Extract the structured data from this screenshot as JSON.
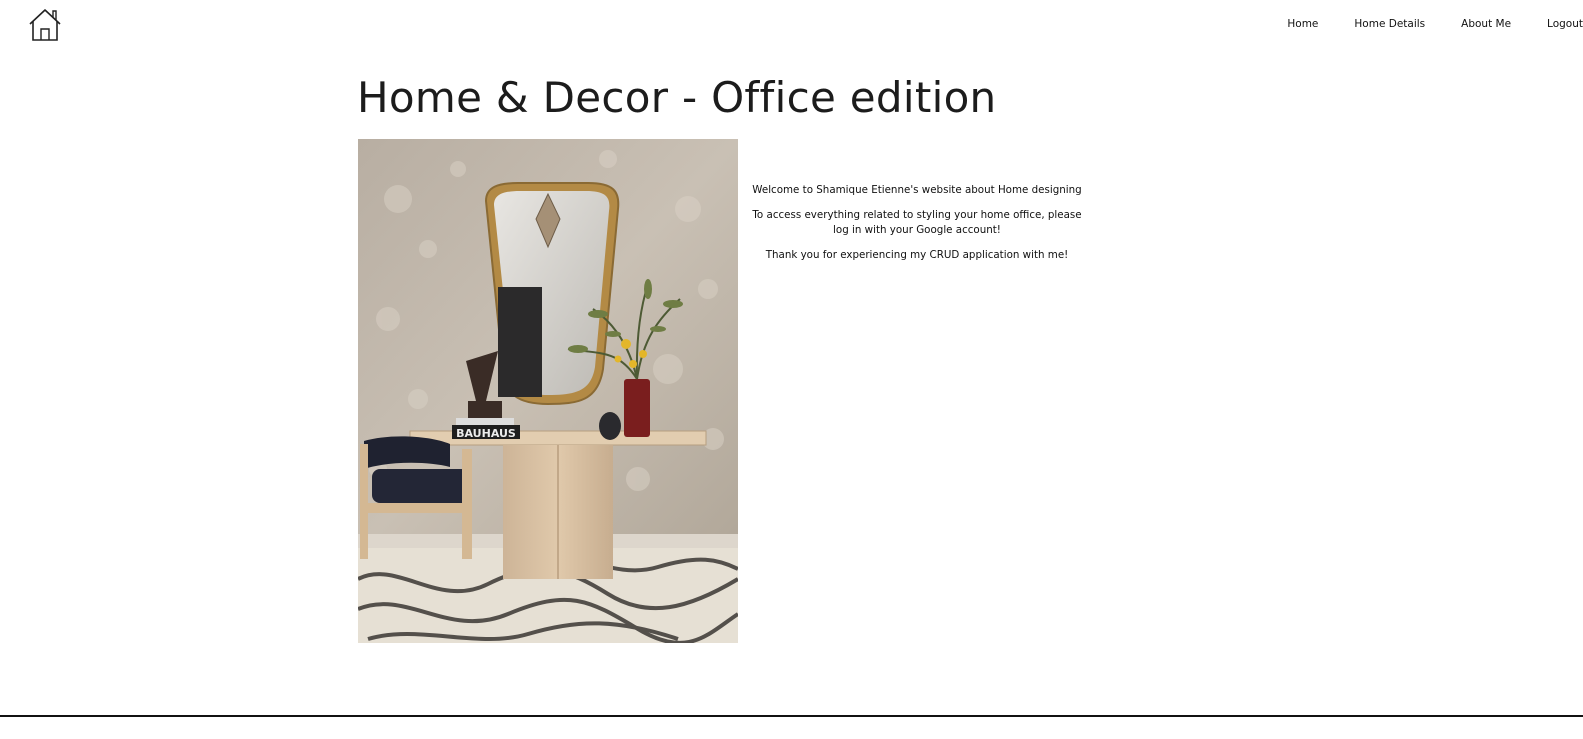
{
  "header": {
    "logo_icon": "house-outline-icon",
    "nav": [
      {
        "label": "Home"
      },
      {
        "label": "Home Details"
      },
      {
        "label": "About Me"
      },
      {
        "label": "Logout"
      }
    ]
  },
  "main": {
    "title": "Home & Decor - Office edition",
    "image_subject": "home-office-interior-photo",
    "book_spine_text": "BAUHAUS",
    "intro": [
      "Welcome to Shamique Etienne's website about Home designing",
      "To access everything related to styling your home office, please log in with your Google account!",
      "Thank you for experiencing my CRUD application with me!"
    ]
  },
  "colors": {
    "background": "#ffffff",
    "text": "#1a1a1a",
    "footer_rule": "#111111"
  }
}
